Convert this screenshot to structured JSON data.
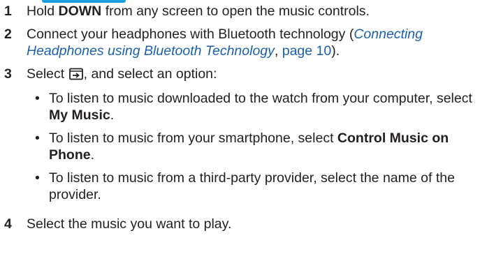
{
  "steps": [
    {
      "num": "1",
      "pre": "Hold ",
      "bold": "DOWN",
      "post": " from any screen to open the music controls."
    },
    {
      "num": "2",
      "pre": "Connect your headphones with Bluetooth technology (",
      "link": "Connecting Headphones using Bluetooth Technology",
      "mid": ", ",
      "page": "page 10",
      "post": ")."
    },
    {
      "num": "3",
      "pre": "Select ",
      "icon": "music-options-icon",
      "post": ", and select an option:",
      "bullets": [
        {
          "pre": "To listen to music downloaded to the watch from your computer, select ",
          "bold": "My Music",
          "post": "."
        },
        {
          "pre": "To listen to music from your smartphone, select ",
          "bold": "Control Music on Phone",
          "post": "."
        },
        {
          "pre": "To listen to music from a third-party provider, select the name of the provider.",
          "bold": "",
          "post": ""
        }
      ]
    },
    {
      "num": "4",
      "pre": "Select the music you want to play."
    }
  ],
  "bullet_glyph": "•",
  "colors": {
    "text": "#231f20",
    "link": "#1a5fb4",
    "heading_accent": "#1aa0dc"
  }
}
